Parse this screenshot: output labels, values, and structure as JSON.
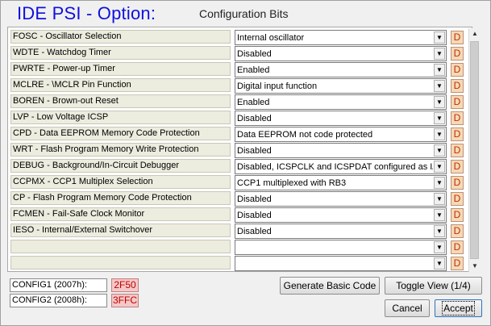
{
  "header": {
    "title": "IDE PSI - Option:",
    "subtitle": "Configuration Bits"
  },
  "rows": [
    {
      "label": "FOSC - Oscillator Selection",
      "value": "Internal oscillator",
      "flag": "D"
    },
    {
      "label": "WDTE - Watchdog Timer",
      "value": "Disabled",
      "flag": "D"
    },
    {
      "label": "PWRTE - Power-up Timer",
      "value": "Enabled",
      "flag": "D"
    },
    {
      "label": "MCLRE - \\MCLR Pin Function",
      "value": "Digital input function",
      "flag": "D"
    },
    {
      "label": "BOREN - Brown-out Reset",
      "value": "Enabled",
      "flag": "D"
    },
    {
      "label": "LVP - Low Voltage ICSP",
      "value": "Disabled",
      "flag": "D"
    },
    {
      "label": "CPD - Data EEPROM Memory Code Protection",
      "value": "Data EEPROM not code protected",
      "flag": "D"
    },
    {
      "label": "WRT - Flash Program Memory Write Protection",
      "value": "Disabled",
      "flag": "D"
    },
    {
      "label": "DEBUG - Background/In-Circuit Debugger",
      "value": "Disabled, ICSPCLK and ICSPDAT configured as I/O",
      "flag": "D"
    },
    {
      "label": "CCPMX - CCP1 Multiplex Selection",
      "value": "CCP1 multiplexed with RB3",
      "flag": "D"
    },
    {
      "label": "CP - Flash Program Memory Code Protection",
      "value": "Disabled",
      "flag": "D"
    },
    {
      "label": "FCMEN - Fail-Safe Clock Monitor",
      "value": "Disabled",
      "flag": "D"
    },
    {
      "label": "IESO - Internal/External Switchover",
      "value": "Disabled",
      "flag": "D"
    },
    {
      "label": "",
      "value": "",
      "flag": "D"
    },
    {
      "label": "",
      "value": "",
      "flag": "D"
    }
  ],
  "config": [
    {
      "label": "CONFIG1 (2007h):",
      "value": "2F50"
    },
    {
      "label": "CONFIG2 (2008h):",
      "value": "3FFC"
    }
  ],
  "buttons": {
    "generate": "Generate Basic Code",
    "toggle": "Toggle View  (1/4)",
    "cancel": "Cancel",
    "accept": "Accept"
  },
  "icons": {
    "dropdown": "chevron-down-icon",
    "scroll_up": "arrow-up-icon",
    "scroll_down": "arrow-down-icon"
  }
}
